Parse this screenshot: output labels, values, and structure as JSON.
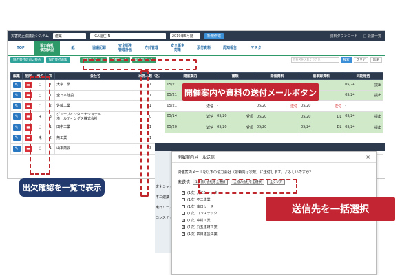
{
  "topbar": {
    "app_title": "災害防止協議会システム",
    "site_select": "建築",
    "project_select": "- GA福住(N",
    "month_select": "2019年5月度",
    "new_button": "新規作成",
    "download": "資料ダウンロード",
    "list_link": "□ 会議一覧"
  },
  "nav": [
    {
      "label": "TOP"
    },
    {
      "label": "協力会社\n参加状況",
      "active": true
    },
    {
      "label": "紙"
    },
    {
      "label": "協議記録"
    },
    {
      "label": "安全衛生\n管理計画"
    },
    {
      "label": "方針管理"
    },
    {
      "label": "安全衛生\n対策"
    },
    {
      "label": "添付資料"
    },
    {
      "label": "周知報告"
    },
    {
      "label": "マスタ"
    }
  ],
  "subbar": {
    "btn_bulk": "協力会社の追い掛込",
    "btn_add": "協力会社追加",
    "btn_mail1": "開催案内メール",
    "btn_mail2": "書類メール",
    "btn_mail3": "資料付メール",
    "search_placeholder": "会社名を入れください",
    "search_btn": "検索",
    "clear_btn": "クリア",
    "print_btn": "印刷"
  },
  "table": {
    "headers": [
      "編集",
      "削除",
      "出欠",
      "次",
      "会社名",
      "出席人数（名）",
      "開催案内",
      "書類",
      "開催資料",
      "議事録資料",
      "同期報告"
    ],
    "rows": [
      {
        "att": "○",
        "no": "1",
        "name": "大学工業",
        "count": "1",
        "d1": "05/21",
        "s1": "返信",
        "d2": "05/20",
        "s2": "既確",
        "d3": "05/21",
        "s3": "送付",
        "d4": "05/24",
        "s4": "",
        "d5": "05/24",
        "s5": "提出",
        "green": true
      },
      {
        "att": "○",
        "no": "1",
        "name": "全日本建設",
        "count": "1",
        "d1": "05/21",
        "s1": "返信",
        "d2": "05/20",
        "s2": "受領",
        "d3": "05/21",
        "s3": "",
        "d4": "05/24",
        "s4": "",
        "d5": "05/24",
        "s5": "提出",
        "green": true
      },
      {
        "att": "○",
        "no": "2",
        "name": "佐藤工業",
        "count": "1",
        "d1": "05/21",
        "s1": "返信",
        "d2": "-",
        "s2": "",
        "d3": "05/20",
        "s3": "送付",
        "d4": "05/20",
        "s4": "送付",
        "d5": "-",
        "s5": "",
        "green": false
      },
      {
        "att": "+",
        "no": "3",
        "name": "グループインターナショナル\nホールディングス株式会社",
        "count": "0",
        "d1": "05/14",
        "s1": "返信",
        "d2": "05/20",
        "s2": "受領",
        "d3": "05/20",
        "s3": "",
        "d4": "05/20",
        "s4": "DL",
        "d5": "05/24",
        "s5": "提出",
        "green": true
      },
      {
        "att": "○",
        "no": "1",
        "name": "田中工業",
        "count": "1",
        "d1": "05/20",
        "s1": "返信",
        "d2": "05/20",
        "s2": "受領",
        "d3": "05/20",
        "s3": "",
        "d4": "05/24",
        "s4": "DL",
        "d5": "05/24",
        "s5": "提出",
        "green": true
      },
      {
        "att": "未",
        "no": "2",
        "name": "無工業",
        "count": "1",
        "d1": "",
        "s1": "",
        "d2": "",
        "s2": "",
        "d3": "",
        "s3": "",
        "d4": "",
        "s4": "",
        "d5": "",
        "s5": "",
        "green": false
      },
      {
        "att": "○",
        "no": "1",
        "name": "山本商会",
        "count": "3",
        "d1": "",
        "s1": "",
        "d2": "",
        "s2": "",
        "d3": "",
        "s3": "",
        "d4": "",
        "s4": "",
        "d5": "",
        "s5": "",
        "green": false
      }
    ]
  },
  "modal": {
    "title": "開催案内メール送信",
    "message": "開催案内メールを以下の協力会社（依頼内は次数）に送付します。よろしいですか？",
    "unsent_label": "未送信",
    "opt1": "1次協力会社を全選択",
    "opt2": "全協力会社を全選択",
    "opt3": "全クリア",
    "companies": [
      {
        "label": "(1次) 大江シャッター",
        "checked": true
      },
      {
        "label": "(1次) 不二建業",
        "checked": false
      },
      {
        "label": "(1次) 東日リース",
        "checked": false
      },
      {
        "label": "(1次) コンステック",
        "checked": false
      },
      {
        "label": "(1次) 中村工業",
        "checked": true
      },
      {
        "label": "(1次) 丸五建材工業",
        "checked": true
      },
      {
        "label": "(1次) 四日建設工業",
        "checked": true
      }
    ]
  },
  "bg_side": [
    "文化シャッター",
    "不二建業",
    "東日リース",
    "コンステック"
  ],
  "callouts": {
    "c1": "開催案内や資料の送付メールボタン",
    "c2": "出欠確認を一覧で表示",
    "c3": "送信先を一括選択"
  }
}
